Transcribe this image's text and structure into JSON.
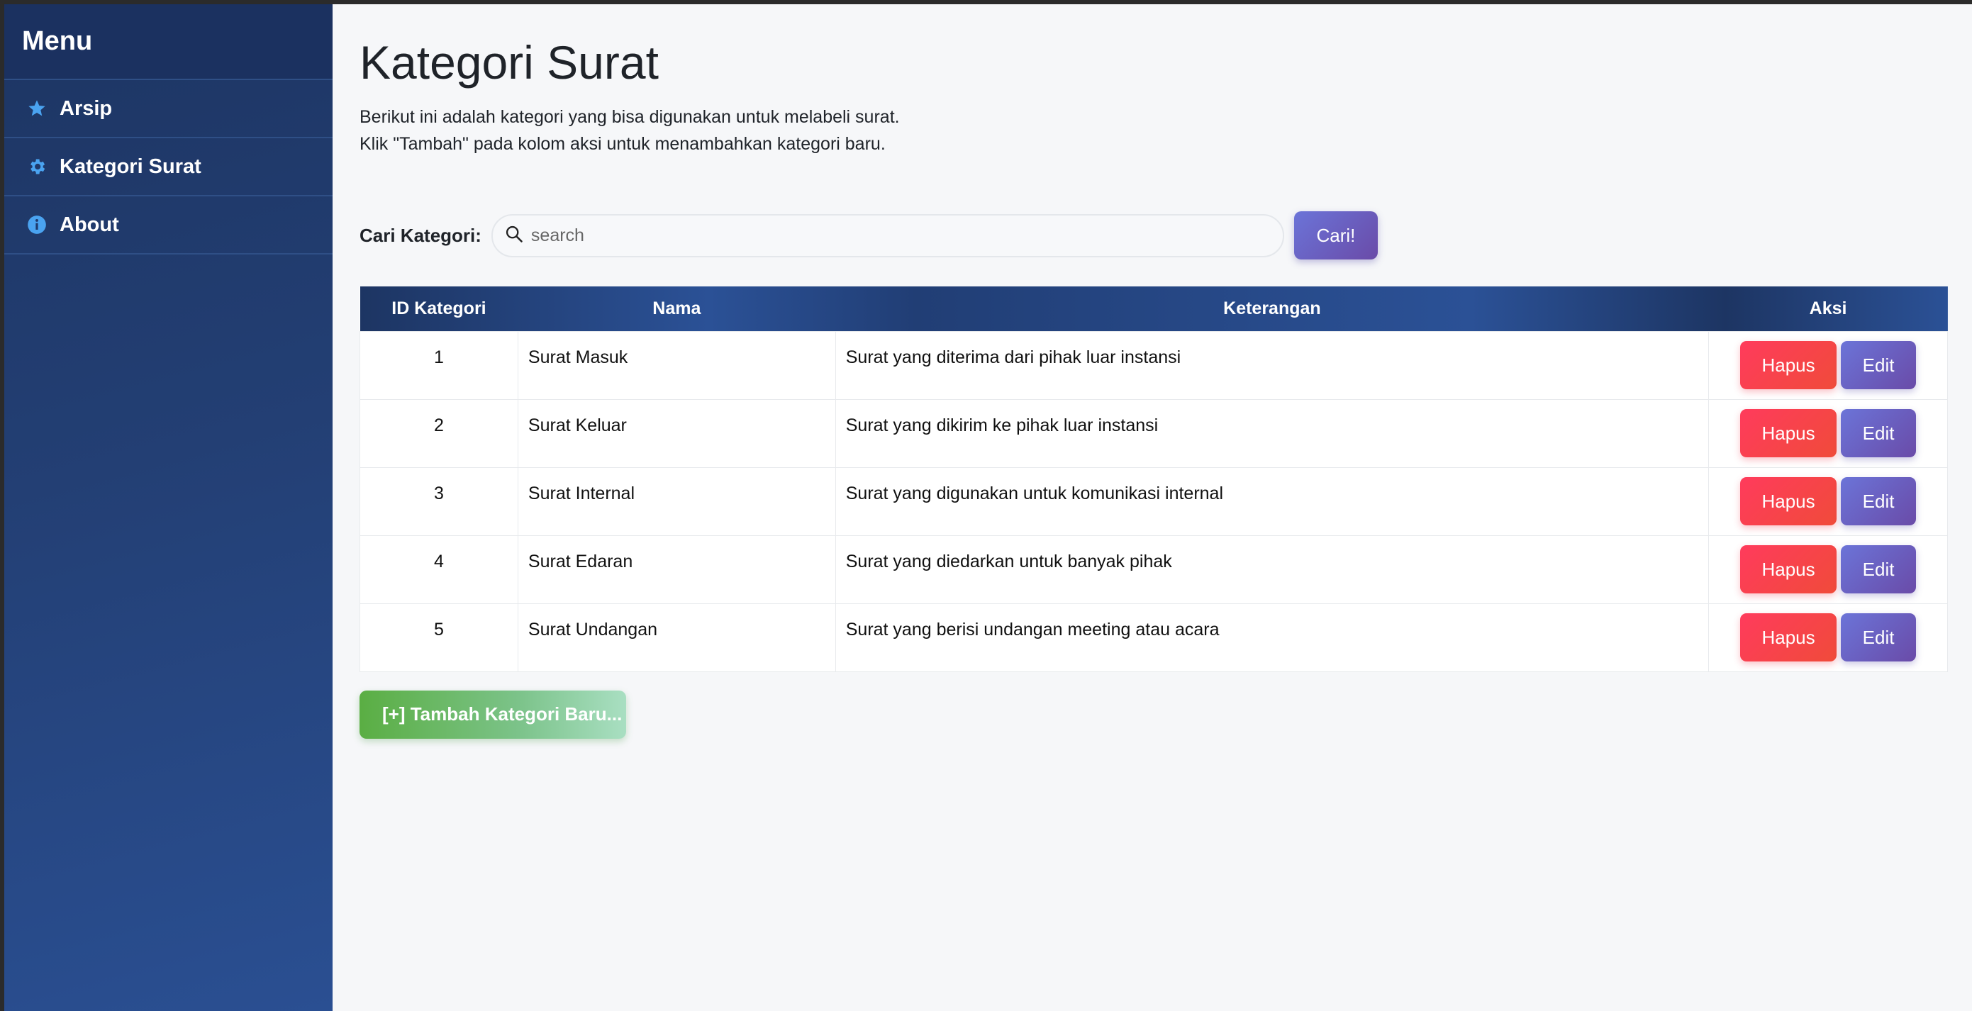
{
  "sidebar": {
    "title": "Menu",
    "items": [
      {
        "label": "Arsip",
        "icon": "star-icon"
      },
      {
        "label": "Kategori Surat",
        "icon": "gear-icon"
      },
      {
        "label": "About",
        "icon": "info-icon"
      }
    ]
  },
  "main": {
    "title": "Kategori Surat",
    "description": [
      "Berikut ini adalah kategori yang bisa digunakan untuk melabeli surat.",
      "Klik \"Tambah\" pada kolom aksi untuk menambahkan kategori baru."
    ],
    "search": {
      "label": "Cari Kategori:",
      "placeholder": "search",
      "value": "",
      "button_label": "Cari!"
    },
    "table": {
      "headers": [
        "ID Kategori",
        "Nama",
        "Keterangan",
        "Aksi"
      ],
      "rows": [
        {
          "id": "1",
          "nama": "Surat Masuk",
          "keterangan": "Surat yang diterima dari pihak luar instansi",
          "hapus": "Hapus",
          "edit": "Edit"
        },
        {
          "id": "2",
          "nama": "Surat Keluar",
          "keterangan": "Surat yang dikirim ke pihak luar instansi",
          "hapus": "Hapus",
          "edit": "Edit"
        },
        {
          "id": "3",
          "nama": "Surat Internal",
          "keterangan": "Surat yang digunakan untuk komunikasi internal",
          "hapus": "Hapus",
          "edit": "Edit"
        },
        {
          "id": "4",
          "nama": "Surat Edaran",
          "keterangan": "Surat yang diedarkan untuk banyak pihak",
          "hapus": "Hapus",
          "edit": "Edit"
        },
        {
          "id": "5",
          "nama": "Surat Undangan",
          "keterangan": "Surat yang berisi undangan meeting atau acara",
          "hapus": "Hapus",
          "edit": "Edit"
        }
      ]
    },
    "add_button_label": "[+] Tambah Kategori Baru..."
  },
  "colors": {
    "sidebar": "#1d3563",
    "accent": "#6a5bc4",
    "danger": "#ff3b5c",
    "success": "#5aae43",
    "icon": "#4aa3f0"
  }
}
